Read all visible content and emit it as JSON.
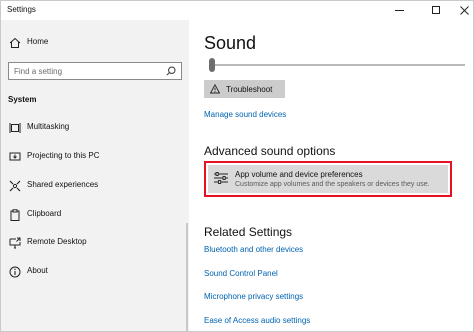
{
  "window": {
    "title": "Settings"
  },
  "sidebar": {
    "home_label": "Home",
    "search_placeholder": "Find a setting",
    "section_label": "System",
    "items": [
      {
        "label": "Multitasking",
        "icon": "multitasking-icon"
      },
      {
        "label": "Projecting to this PC",
        "icon": "projecting-icon"
      },
      {
        "label": "Shared experiences",
        "icon": "shared-experiences-icon"
      },
      {
        "label": "Clipboard",
        "icon": "clipboard-icon"
      },
      {
        "label": "Remote Desktop",
        "icon": "remote-desktop-icon"
      },
      {
        "label": "About",
        "icon": "info-icon"
      }
    ]
  },
  "main": {
    "title": "Sound",
    "troubleshoot_label": "Troubleshoot",
    "manage_link": "Manage sound devices",
    "advanced_heading": "Advanced sound options",
    "app_volume": {
      "title": "App volume and device preferences",
      "subtitle": "Customize app volumes and the speakers or devices they use."
    },
    "related_heading": "Related Settings",
    "related_links": [
      "Bluetooth and other devices",
      "Sound Control Panel",
      "Microphone privacy settings",
      "Ease of Access audio settings"
    ]
  },
  "colors": {
    "accent_link": "#0063b1",
    "highlight_border": "#e81123",
    "sidebar_bg": "#f2f2f2"
  }
}
